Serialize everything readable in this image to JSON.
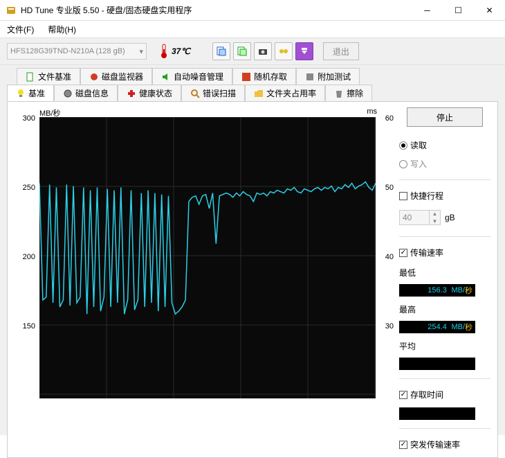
{
  "window": {
    "title": "HD Tune 专业版 5.50 - 硬盘/固态硬盘实用程序"
  },
  "menu": {
    "file": "文件(F)",
    "help": "帮助(H)"
  },
  "toolbar": {
    "drive": "HFS128G39TND-N210A (128 gB)",
    "temp": "37℃",
    "exit": "退出"
  },
  "tabs_row1": {
    "file_benchmark": "文件基准",
    "disk_monitor": "磁盘监视器",
    "aam": "自动噪音管理",
    "random_access": "随机存取",
    "extra_tests": "附加测试"
  },
  "tabs_row2": {
    "benchmark": "基准",
    "disk_info": "磁盘信息",
    "health": "健康状态",
    "error_scan": "错误扫描",
    "folder_usage": "文件夹占用率",
    "erase": "擦除"
  },
  "chart": {
    "y_left_unit": "MB/秒",
    "y_right_unit": "ms",
    "y_left_ticks": [
      "300",
      "250",
      "200",
      "150"
    ],
    "y_right_ticks": [
      "60",
      "50",
      "40",
      "30"
    ]
  },
  "side": {
    "stop": "停止",
    "read": "读取",
    "write": "写入",
    "short_stroke": "快捷行程",
    "stroke_val": "40",
    "stroke_unit": "gB",
    "transfer_rate": "传输速率",
    "min_label": "最低",
    "min_val": "156.3",
    "max_label": "最高",
    "max_val": "254.4",
    "avg_label": "平均",
    "unit_mb": "MB/",
    "unit_sec": "秒",
    "access_time": "存取时间",
    "burst_rate": "突发传输速率"
  },
  "chart_data": {
    "type": "line",
    "title": "",
    "xlabel": "",
    "ylabel": "MB/秒",
    "ylim_left": [
      100,
      300
    ],
    "ylim_right": [
      20,
      60
    ],
    "x": [
      0,
      1,
      2,
      3,
      4,
      5,
      6,
      7,
      8,
      9,
      10,
      11,
      12,
      13,
      14,
      15,
      16,
      17,
      18,
      19,
      20,
      21,
      22,
      23,
      24,
      25,
      26,
      27,
      28,
      29,
      30,
      31,
      32,
      33,
      34,
      35,
      36,
      37,
      38,
      39,
      40,
      41,
      42,
      43,
      44,
      45,
      46,
      47,
      48,
      49,
      50,
      51,
      52,
      53,
      54,
      55,
      56,
      57,
      58,
      59,
      60,
      61,
      62,
      63,
      64,
      65,
      66,
      67,
      68,
      69,
      70,
      71,
      72,
      73,
      74,
      75,
      76,
      77,
      78,
      79,
      80,
      81,
      82,
      83,
      84,
      85,
      86,
      87,
      88,
      89,
      90,
      91,
      92,
      93,
      94,
      95,
      96,
      97,
      98,
      99
    ],
    "series": [
      {
        "name": "传输速率",
        "values": [
          253,
          170,
          172,
          252,
          168,
          250,
          165,
          170,
          252,
          166,
          251,
          168,
          172,
          250,
          160,
          248,
          165,
          250,
          162,
          172,
          249,
          165,
          248,
          168,
          250,
          160,
          170,
          248,
          163,
          170,
          246,
          165,
          248,
          168,
          246,
          162,
          245,
          165,
          244,
          168,
          160,
          162,
          165,
          170,
          240,
          243,
          244,
          238,
          244,
          245,
          235,
          246,
          210,
          244,
          245,
          246,
          245,
          243,
          246,
          244,
          247,
          245,
          244,
          240,
          246,
          245,
          246,
          244,
          247,
          246,
          248,
          247,
          246,
          249,
          248,
          250,
          247,
          246,
          249,
          248,
          247,
          249,
          250,
          248,
          250,
          249,
          251,
          247,
          250,
          249,
          252,
          250,
          253,
          249,
          251,
          252,
          254,
          250,
          248,
          253
        ]
      }
    ]
  }
}
